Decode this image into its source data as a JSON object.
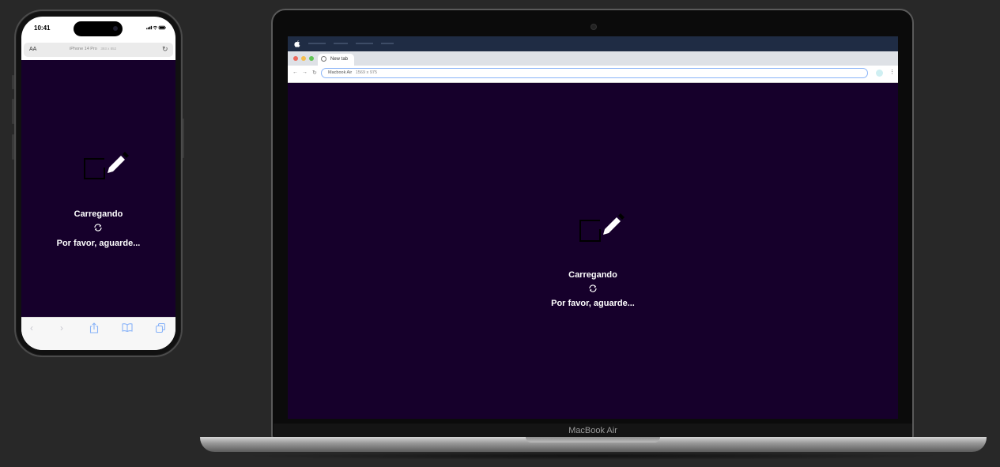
{
  "phone": {
    "status_time": "10:41",
    "url_aa": "AA",
    "url_device": "iPhone 14 Pro",
    "url_dimensions": "393 x 852",
    "loader": {
      "title": "Carregando",
      "subtitle": "Por favor, aguarde..."
    },
    "toolbar": {
      "back_icon": "chevron-left-icon",
      "forward_icon": "chevron-right-icon",
      "share_icon": "share-icon",
      "bookmarks_icon": "book-icon",
      "tabs_icon": "tabs-icon"
    }
  },
  "laptop": {
    "tab_label": "New tab",
    "omnibox_device": "Macbook Air",
    "omnibox_dimensions": "1569 x 975",
    "loader": {
      "title": "Carregando",
      "subtitle": "Por favor, aguarde..."
    },
    "device_label": "MacBook Air"
  },
  "colors": {
    "page_background": "#282828",
    "app_background": "#16002b",
    "loader_text": "#ffffff",
    "accent_blue": "#8ab4f8"
  }
}
